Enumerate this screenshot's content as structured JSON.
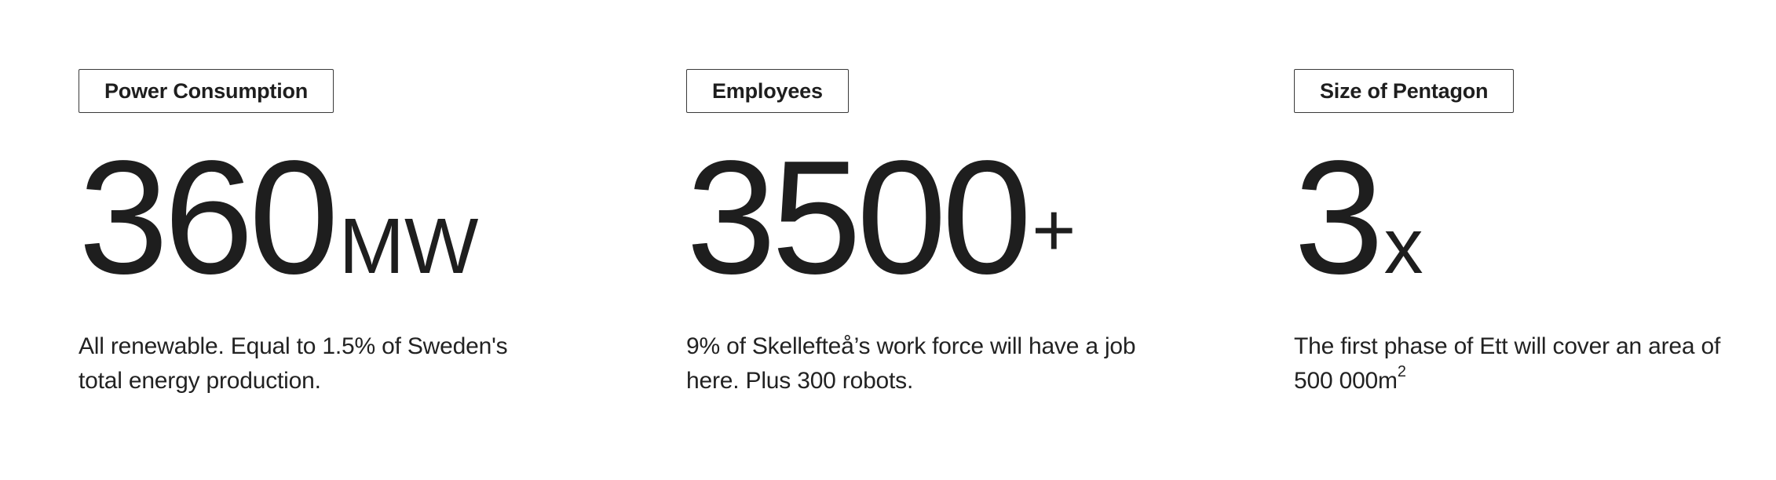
{
  "stats": [
    {
      "label": "Power Consumption",
      "value": "360",
      "unit": "MW",
      "description": "All renewable. Equal to 1.5% of Sweden's total energy production."
    },
    {
      "label": "Employees",
      "value": "3500",
      "unit": "+",
      "description": "9% of Skellefteå’s work force will have a job here. Plus 300 robots."
    },
    {
      "label": "Size of Pentagon",
      "value": "3",
      "unit": "x",
      "description": "The first phase of Ett will cover an area of 500 000m",
      "description_superscript": "2"
    }
  ]
}
